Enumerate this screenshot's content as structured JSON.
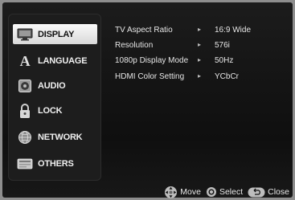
{
  "menu": [
    {
      "id": "display",
      "label": "DISPLAY",
      "icon": "display-icon",
      "selected": true
    },
    {
      "id": "language",
      "label": "LANGUAGE",
      "icon": "language-icon",
      "selected": false
    },
    {
      "id": "audio",
      "label": "AUDIO",
      "icon": "audio-icon",
      "selected": false
    },
    {
      "id": "lock",
      "label": "LOCK",
      "icon": "lock-icon",
      "selected": false
    },
    {
      "id": "network",
      "label": "NETWORK",
      "icon": "network-icon",
      "selected": false
    },
    {
      "id": "others",
      "label": "OTHERS",
      "icon": "others-icon",
      "selected": false
    }
  ],
  "settings": [
    {
      "name": "TV Aspect Ratio",
      "value": "16:9 Wide"
    },
    {
      "name": "Resolution",
      "value": "576i"
    },
    {
      "name": "1080p Display Mode",
      "value": "50Hz"
    },
    {
      "name": "HDMI Color Setting",
      "value": "YCbCr"
    }
  ],
  "footer": {
    "move_label": "Move",
    "select_label": "Select",
    "close_label": "Close"
  },
  "colors": {
    "selected_bg": "#f0f0f0",
    "panel_bg": "#1d1d1d",
    "screen_bg": "#141414",
    "text": "#e6e6e6"
  }
}
